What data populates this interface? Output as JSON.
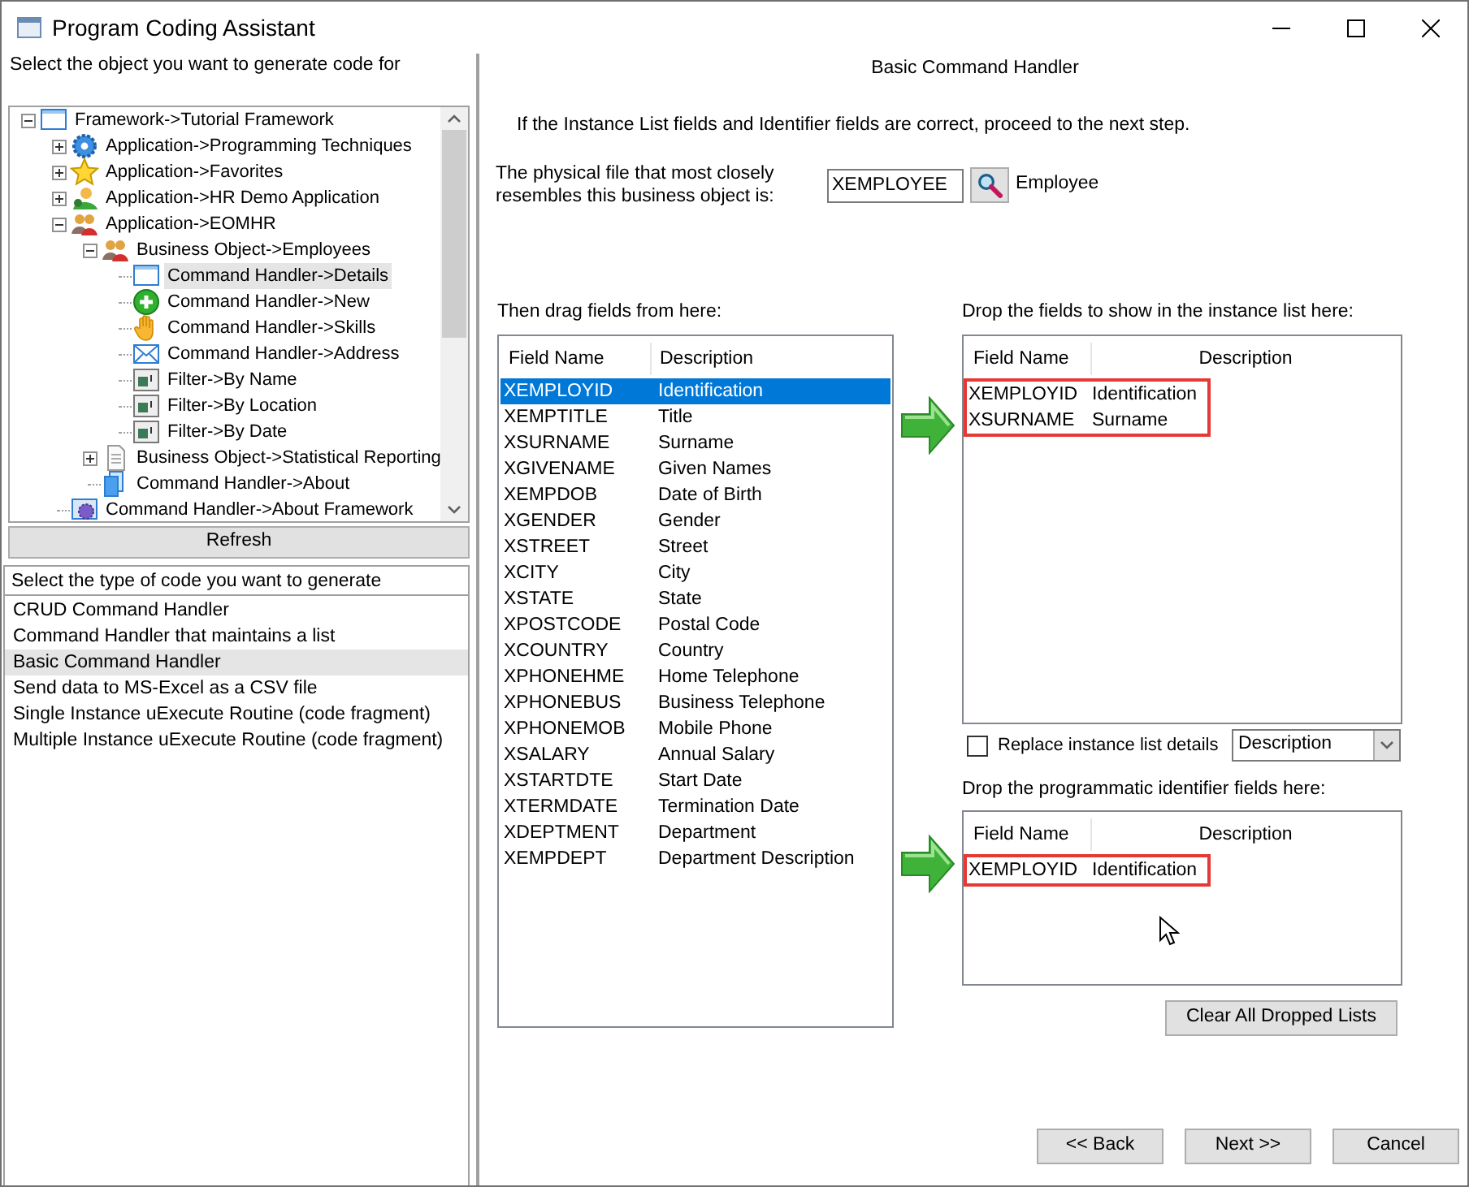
{
  "window": {
    "title": "Program Coding Assistant"
  },
  "object_panel": {
    "label": "Select the object you want to generate code for",
    "tree": [
      {
        "label": "Framework->Tutorial Framework",
        "kind": "window",
        "expanded": true,
        "selected": false,
        "children": [
          {
            "label": "Application->Programming Techniques",
            "kind": "gear",
            "expanded": false,
            "selected": false
          },
          {
            "label": "Application->Favorites",
            "kind": "star",
            "expanded": false,
            "selected": false
          },
          {
            "label": "Application->HR Demo Application",
            "kind": "person",
            "expanded": false,
            "selected": false
          },
          {
            "label": "Application->EOMHR",
            "kind": "people",
            "expanded": true,
            "selected": false,
            "children": [
              {
                "label": "Business Object->Employees",
                "kind": "people",
                "expanded": true,
                "selected": false,
                "children": [
                  {
                    "label": "Command Handler->Details",
                    "kind": "window",
                    "selected": true
                  },
                  {
                    "label": "Command Handler->New",
                    "kind": "plus",
                    "selected": false
                  },
                  {
                    "label": "Command Handler->Skills",
                    "kind": "hand",
                    "selected": false
                  },
                  {
                    "label": "Command Handler->Address",
                    "kind": "mail",
                    "selected": false
                  },
                  {
                    "label": "Filter->By Name",
                    "kind": "filter",
                    "selected": false
                  },
                  {
                    "label": "Filter->By Location",
                    "kind": "filter",
                    "selected": false
                  },
                  {
                    "label": "Filter->By Date",
                    "kind": "filter",
                    "selected": false
                  }
                ]
              },
              {
                "label": "Business Object->Statistical Reporting",
                "kind": "document",
                "expanded": false,
                "selected": false
              },
              {
                "label": "Command Handler->About",
                "kind": "pages",
                "selected": false
              }
            ]
          },
          {
            "label": "Command Handler->About Framework",
            "kind": "gearwin",
            "selected": false
          }
        ]
      }
    ],
    "refresh_button": "Refresh"
  },
  "code_type_panel": {
    "label": "Select the type of code you want to generate",
    "items": [
      {
        "label": "CRUD Command Handler",
        "selected": false
      },
      {
        "label": "Command Handler that maintains a list",
        "selected": false
      },
      {
        "label": "Basic Command Handler",
        "selected": true
      },
      {
        "label": "Send data to MS-Excel as a CSV file",
        "selected": false
      },
      {
        "label": "Single Instance uExecute Routine (code fragment)",
        "selected": false
      },
      {
        "label": "Multiple Instance uExecute Routine (code fragment)",
        "selected": false
      }
    ]
  },
  "wizard": {
    "heading": "Basic Command Handler",
    "instruction": "If  the Instance List fields and Identifier fields are correct, proceed to the next step.",
    "physical_file": {
      "label": "The physical file that most closely resembles this business object is:",
      "value": "XEMPLOYEE",
      "description": "Employee"
    },
    "source_fields": {
      "label": "Then drag fields from here:",
      "columns": [
        "Field Name",
        "Description"
      ],
      "rows": [
        {
          "name": "XEMPLOYID",
          "description": "Identification",
          "selected": true
        },
        {
          "name": "XEMPTITLE",
          "description": "Title",
          "selected": false
        },
        {
          "name": "XSURNAME",
          "description": "Surname",
          "selected": false
        },
        {
          "name": "XGIVENAME",
          "description": "Given Names",
          "selected": false
        },
        {
          "name": "XEMPDOB",
          "description": "Date of Birth",
          "selected": false
        },
        {
          "name": "XGENDER",
          "description": "Gender",
          "selected": false
        },
        {
          "name": "XSTREET",
          "description": "Street",
          "selected": false
        },
        {
          "name": "XCITY",
          "description": "City",
          "selected": false
        },
        {
          "name": "XSTATE",
          "description": "State",
          "selected": false
        },
        {
          "name": "XPOSTCODE",
          "description": "Postal Code",
          "selected": false
        },
        {
          "name": "XCOUNTRY",
          "description": "Country",
          "selected": false
        },
        {
          "name": "XPHONEHME",
          "description": "Home Telephone",
          "selected": false
        },
        {
          "name": "XPHONEBUS",
          "description": "Business Telephone",
          "selected": false
        },
        {
          "name": "XPHONEMOB",
          "description": "Mobile Phone",
          "selected": false
        },
        {
          "name": "XSALARY",
          "description": "Annual Salary",
          "selected": false
        },
        {
          "name": "XSTARTDTE",
          "description": "Start Date",
          "selected": false
        },
        {
          "name": "XTERMDATE",
          "description": "Termination Date",
          "selected": false
        },
        {
          "name": "XDEPTMENT",
          "description": "Department",
          "selected": false
        },
        {
          "name": "XEMPDEPT",
          "description": "Department Description",
          "selected": false
        }
      ]
    },
    "instance_list": {
      "label": "Drop the fields to show in the instance list here:",
      "columns": [
        "Field Name",
        "Description"
      ],
      "rows": [
        {
          "name": "XEMPLOYID",
          "description": "Identification"
        },
        {
          "name": "XSURNAME",
          "description": "Surname"
        }
      ]
    },
    "replace_details": {
      "label": "Replace instance list details",
      "checked": false
    },
    "replace_dropdown": {
      "value": "Description"
    },
    "identifier_list": {
      "label": "Drop the programmatic identifier fields here:",
      "columns": [
        "Field Name",
        "Description"
      ],
      "rows": [
        {
          "name": "XEMPLOYID",
          "description": "Identification"
        }
      ]
    },
    "clear_button": "Clear All Dropped Lists",
    "buttons": [
      "<< Back",
      "Next >>",
      "Cancel"
    ]
  }
}
